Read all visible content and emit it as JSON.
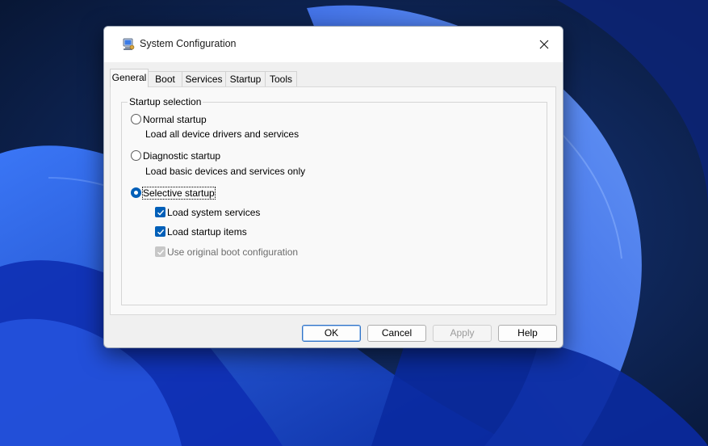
{
  "window": {
    "title": "System Configuration",
    "app_icon": "msconfig-computer-icon",
    "close_icon": "close-icon"
  },
  "tabs": [
    {
      "label": "General",
      "active": true
    },
    {
      "label": "Boot",
      "active": false
    },
    {
      "label": "Services",
      "active": false
    },
    {
      "label": "Startup",
      "active": false
    },
    {
      "label": "Tools",
      "active": false
    }
  ],
  "startup_selection": {
    "legend": "Startup selection",
    "normal": {
      "label": "Normal startup",
      "description": "Load all device drivers and services",
      "selected": false
    },
    "diagnostic": {
      "label": "Diagnostic startup",
      "description": "Load basic devices and services only",
      "selected": false
    },
    "selective": {
      "label": "Selective startup",
      "selected": true,
      "options": [
        {
          "label": "Load system services",
          "checked": true,
          "enabled": true
        },
        {
          "label": "Load startup items",
          "checked": true,
          "enabled": true
        },
        {
          "label": "Use original boot configuration",
          "checked": true,
          "enabled": false
        }
      ]
    }
  },
  "buttons": {
    "ok": "OK",
    "cancel": "Cancel",
    "apply": "Apply",
    "help": "Help"
  },
  "colors": {
    "accent": "#005fb8",
    "wallpaper_dark": "#0a1a3a",
    "wallpaper_blue": "#1a4fd6"
  }
}
